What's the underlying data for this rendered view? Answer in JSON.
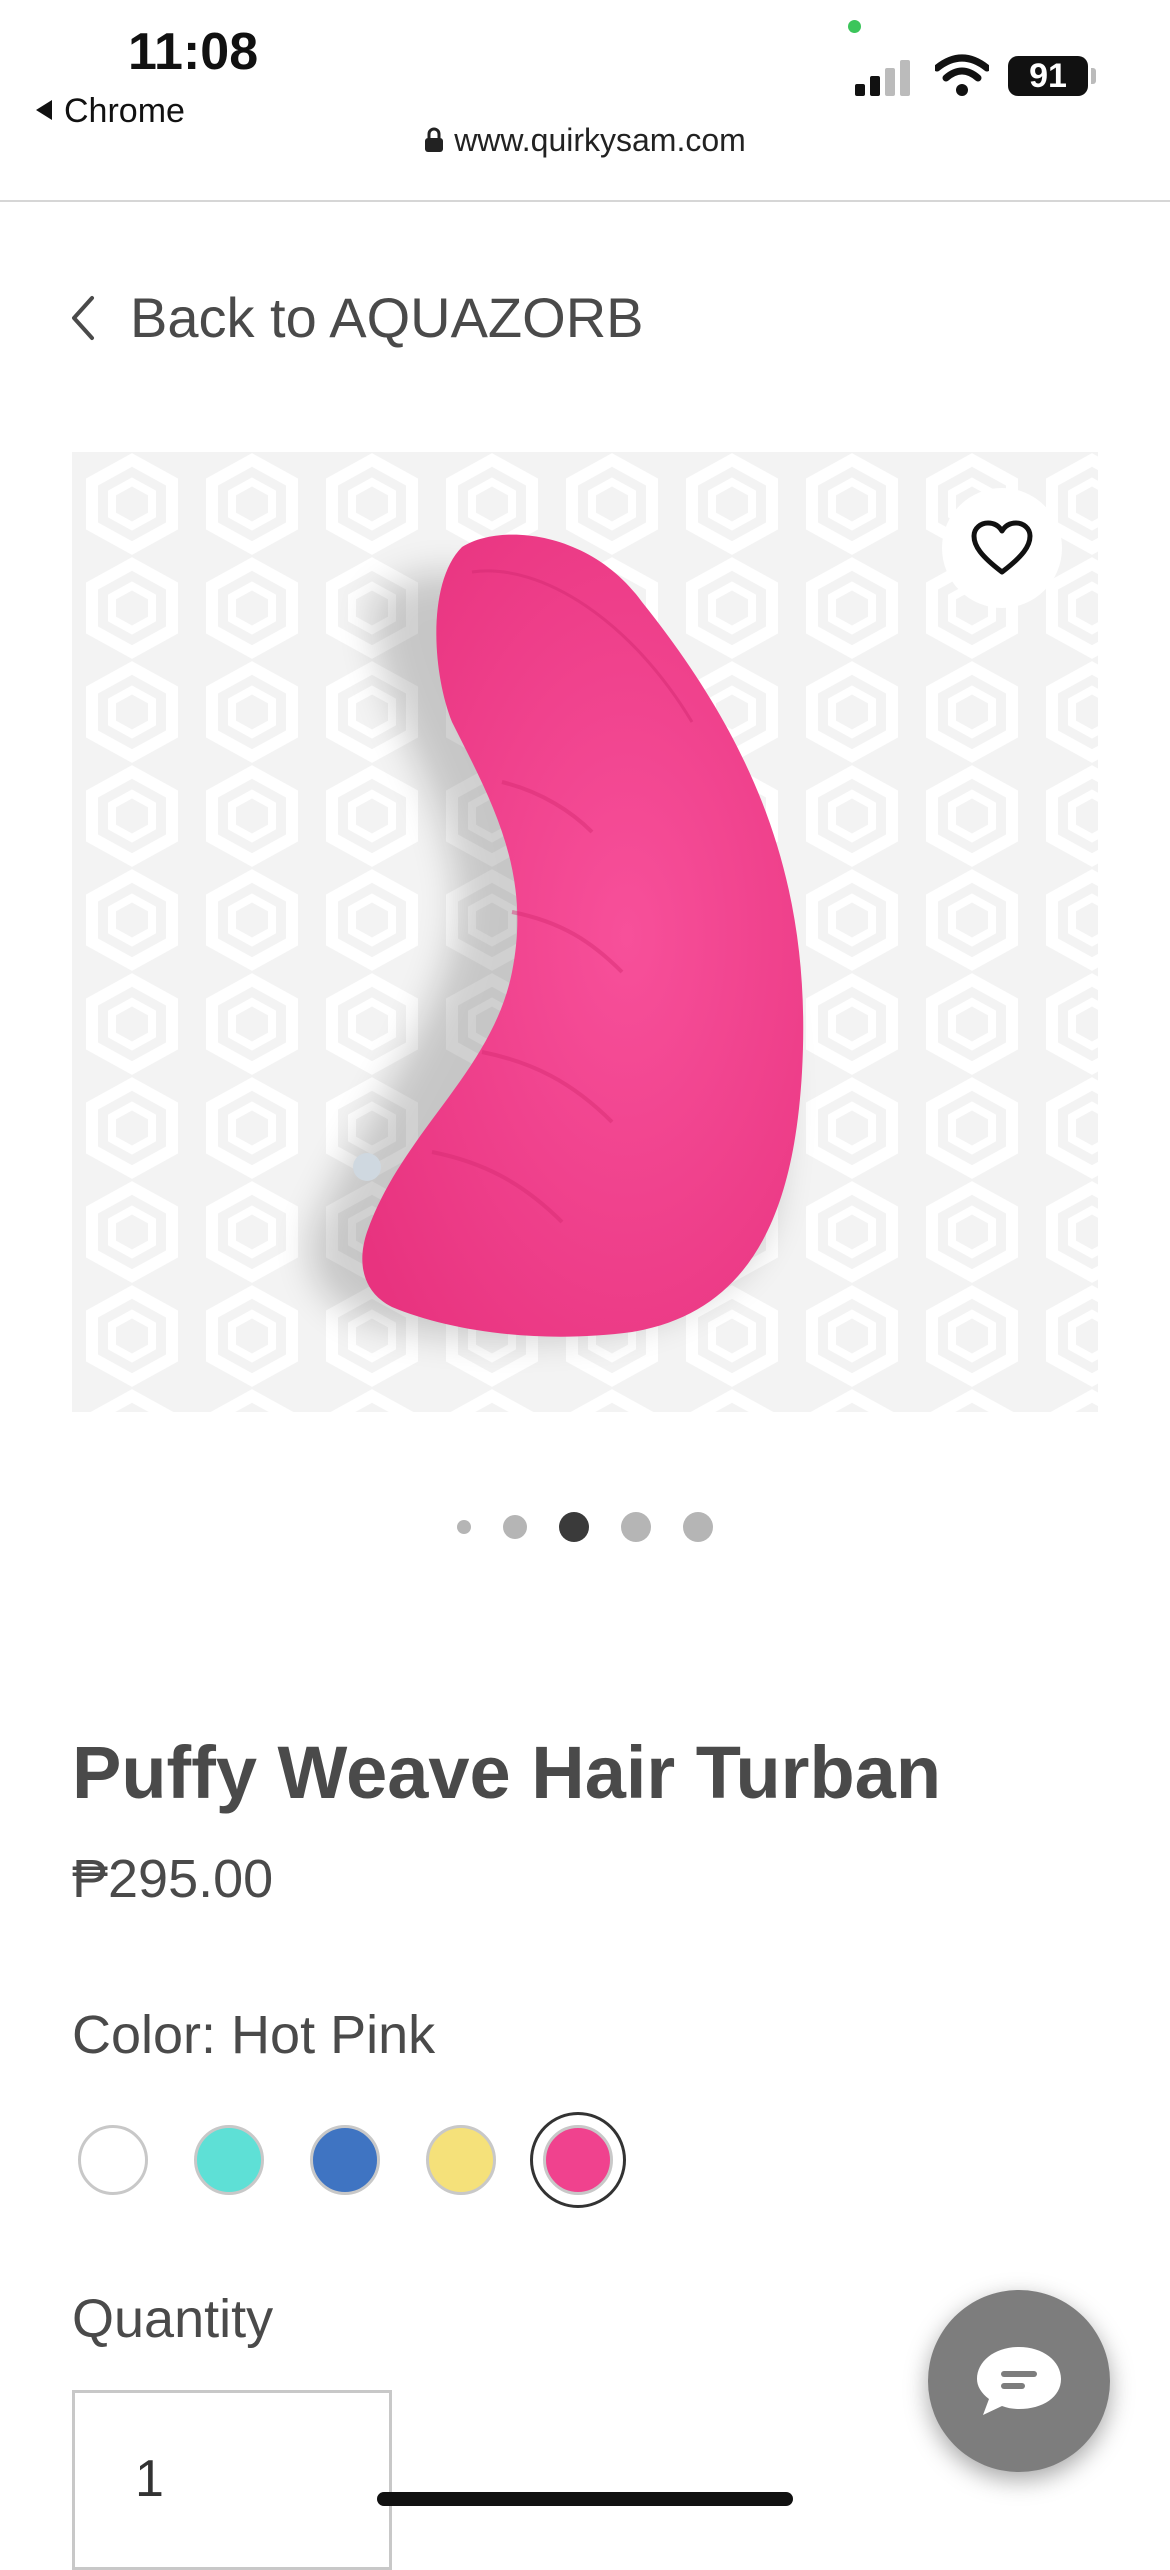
{
  "status": {
    "time": "11:08",
    "back_app": "Chrome",
    "battery": "91",
    "url": "www.quirkysam.com"
  },
  "nav": {
    "back_label": "Back to AQUAZORB"
  },
  "gallery": {
    "total": 5,
    "active_index": 2
  },
  "product": {
    "title": "Puffy Weave Hair Turban",
    "price": "₱295.00",
    "color_label": "Color: Hot Pink",
    "colors": [
      {
        "name": "White",
        "hex": "#ffffff"
      },
      {
        "name": "Turquoise",
        "hex": "#5ee0d6"
      },
      {
        "name": "Blue",
        "hex": "#3f74c2"
      },
      {
        "name": "Yellow",
        "hex": "#f5e17a"
      },
      {
        "name": "Hot Pink",
        "hex": "#f0428e"
      }
    ],
    "selected_color": "Hot Pink",
    "quantity_label": "Quantity",
    "quantity": "1"
  }
}
